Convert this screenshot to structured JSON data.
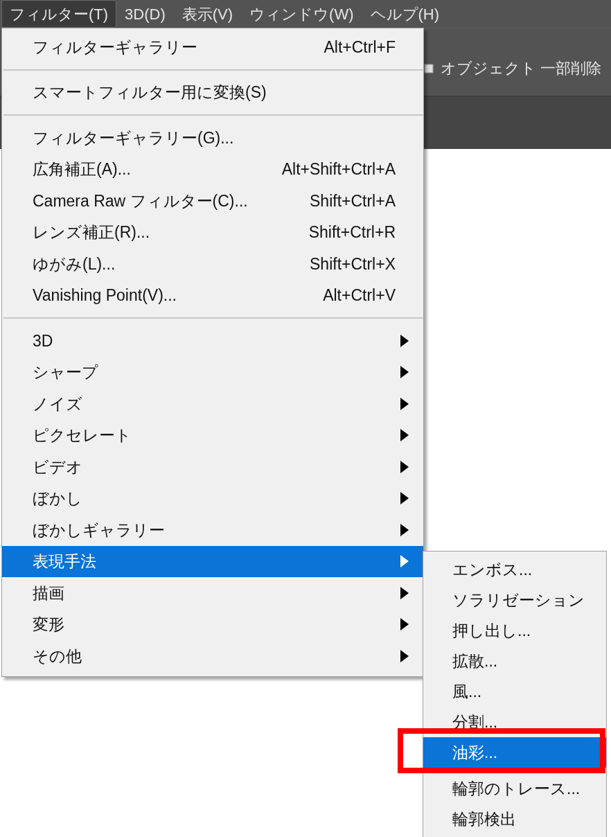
{
  "menubar": [
    {
      "label": "フィルター(T)",
      "selected": true
    },
    {
      "label": "3D(D)",
      "selected": false
    },
    {
      "label": "表示(V)",
      "selected": false
    },
    {
      "label": "ウィンドウ(W)",
      "selected": false
    },
    {
      "label": "ヘルプ(H)",
      "selected": false
    }
  ],
  "options_bar": {
    "checkbox_label": "オブジェクト 一部削除"
  },
  "menu": {
    "items": [
      {
        "kind": "command",
        "label": "フィルターギャラリー",
        "shortcut": "Alt+Ctrl+F"
      },
      {
        "kind": "separator"
      },
      {
        "kind": "command",
        "label": "スマートフィルター用に変換(S)"
      },
      {
        "kind": "separator"
      },
      {
        "kind": "command",
        "label": "フィルターギャラリー(G)..."
      },
      {
        "kind": "command",
        "label": "広角補正(A)...",
        "shortcut": "Alt+Shift+Ctrl+A"
      },
      {
        "kind": "command",
        "label": "Camera Raw フィルター(C)...",
        "shortcut": "Shift+Ctrl+A"
      },
      {
        "kind": "command",
        "label": "レンズ補正(R)...",
        "shortcut": "Shift+Ctrl+R"
      },
      {
        "kind": "command",
        "label": "ゆがみ(L)...",
        "shortcut": "Shift+Ctrl+X"
      },
      {
        "kind": "command",
        "label": "Vanishing Point(V)...",
        "shortcut": "Alt+Ctrl+V"
      },
      {
        "kind": "separator"
      },
      {
        "kind": "submenu",
        "label": "3D",
        "selected": false
      },
      {
        "kind": "submenu",
        "label": "シャープ",
        "selected": false
      },
      {
        "kind": "submenu",
        "label": "ノイズ",
        "selected": false
      },
      {
        "kind": "submenu",
        "label": "ピクセレート",
        "selected": false
      },
      {
        "kind": "submenu",
        "label": "ビデオ",
        "selected": false
      },
      {
        "kind": "submenu",
        "label": "ぼかし",
        "selected": false
      },
      {
        "kind": "submenu",
        "label": "ぼかしギャラリー",
        "selected": false
      },
      {
        "kind": "submenu",
        "label": "表現手法",
        "selected": true
      },
      {
        "kind": "submenu",
        "label": "描画",
        "selected": false
      },
      {
        "kind": "submenu",
        "label": "変形",
        "selected": false
      },
      {
        "kind": "submenu",
        "label": "その他",
        "selected": false
      }
    ]
  },
  "submenu": {
    "items": [
      {
        "label": "エンボス...",
        "selected": false
      },
      {
        "label": "ソラリゼーション",
        "selected": false
      },
      {
        "label": "押し出し...",
        "selected": false
      },
      {
        "label": "拡散...",
        "selected": false
      },
      {
        "label": "風...",
        "selected": false
      },
      {
        "label": "分割...",
        "selected": false
      },
      {
        "label": "油彩...",
        "selected": true
      },
      {
        "label": "輪郭のトレース...",
        "selected": false
      },
      {
        "label": "輪郭検出",
        "selected": false
      }
    ]
  },
  "annotation": {
    "kind": "rectangle"
  }
}
